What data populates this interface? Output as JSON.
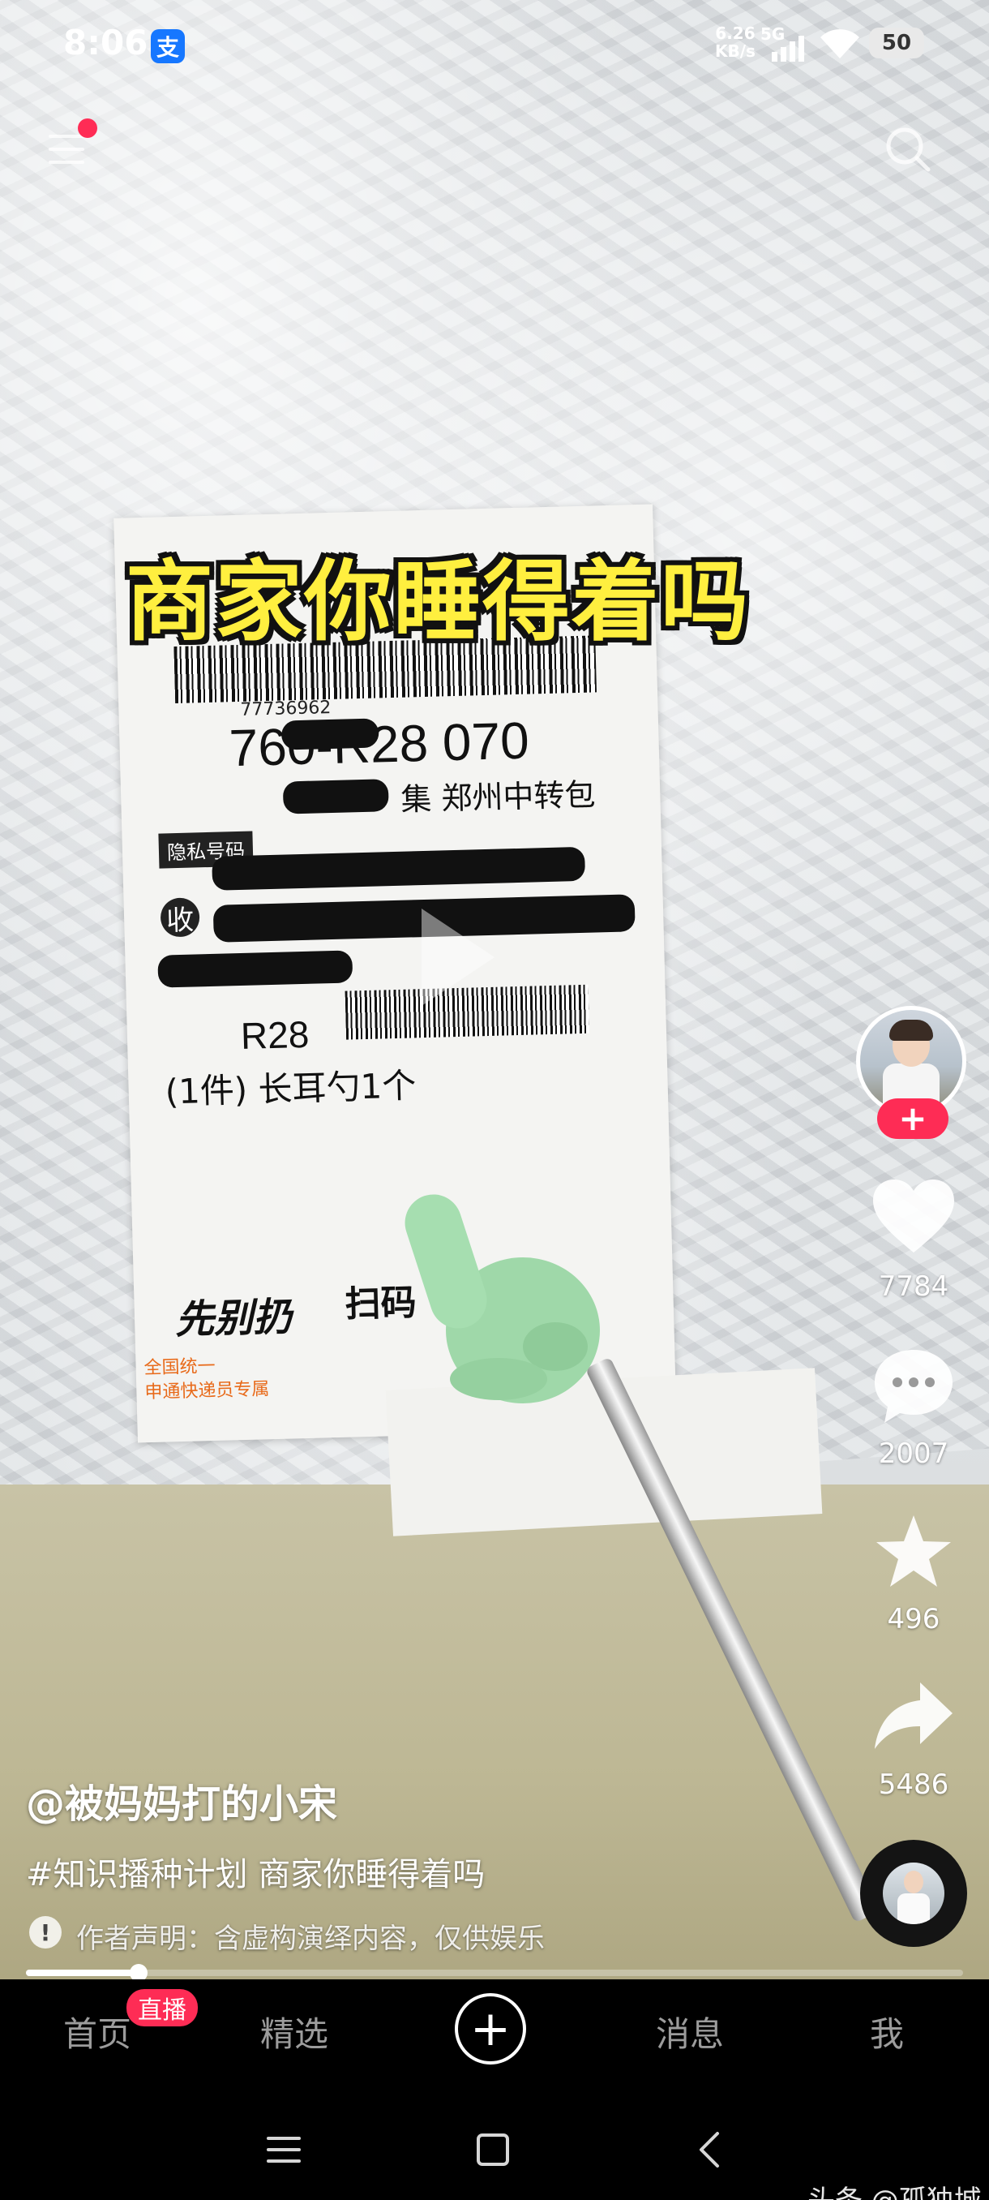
{
  "status_bar": {
    "time": "8:06",
    "app_icon_glyph": "支",
    "net_speed_value": "6.26",
    "net_speed_unit": "KB/s",
    "network_type": "5G",
    "battery": "50",
    "icons": [
      "alipay-icon",
      "signal-icon",
      "wifi-icon",
      "battery-icon"
    ]
  },
  "top_bar": {
    "icons": [
      "menu-icon",
      "search-icon"
    ],
    "notification_dot_color": "#ff2c55"
  },
  "video": {
    "overlay_title": "商家你睡得着吗",
    "overlay_title_color": "#ffef3f",
    "label_texts": {
      "barcode_number": "77736962",
      "route_code": "760-R28 070",
      "transfer": "集 郑州中转包",
      "privacy": "隐私号码",
      "receive": "收",
      "r28": "R28",
      "item": "(1件) 长耳勺1个",
      "brand": "先别扔",
      "brand2": "扫码",
      "hotline": "全国统一",
      "hotline2": "申通快递员专属"
    }
  },
  "actions": {
    "follow_label": "+",
    "like_count": "7784",
    "comment_count": "2007",
    "favorite_count": "496",
    "share_count": "5486",
    "icons": [
      "heart-icon",
      "comment-icon",
      "star-icon",
      "share-icon",
      "music-disc-icon"
    ]
  },
  "caption": {
    "author": "@被妈妈打的小宋",
    "text": "#知识播种计划 商家你睡得着吗",
    "disclaimer_icon_glyph": "!",
    "disclaimer": "作者声明：含虚构演绎内容，仅供娱乐"
  },
  "progress": {
    "fraction": 0.12
  },
  "tab_bar": {
    "tabs": [
      {
        "label": "首页"
      },
      {
        "label": "精选"
      },
      {
        "label": "消息"
      },
      {
        "label": "我"
      }
    ],
    "live_badge": "直播",
    "create_label": "+",
    "accent_color": "#fe2c55"
  },
  "system_nav": {
    "icons": [
      "recents-icon",
      "home-icon",
      "back-icon"
    ]
  },
  "watermark": "头条 @孤独城"
}
